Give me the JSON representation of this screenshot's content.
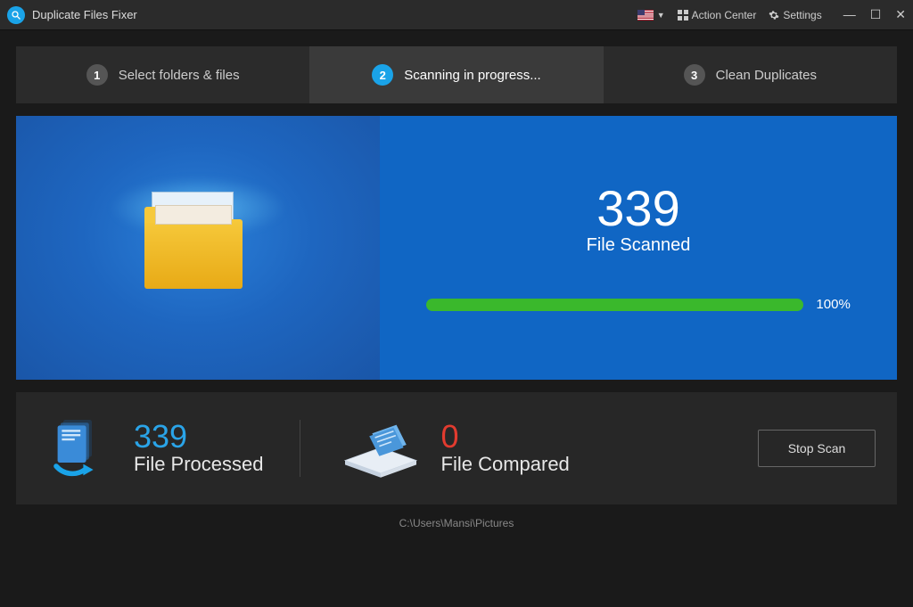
{
  "titlebar": {
    "app_name": "Duplicate Files Fixer",
    "action_center": "Action Center",
    "settings": "Settings"
  },
  "steps": {
    "s1_num": "1",
    "s1_label": "Select folders & files",
    "s2_num": "2",
    "s2_label": "Scanning in progress...",
    "s3_num": "3",
    "s3_label": "Clean Duplicates"
  },
  "hero": {
    "scanned_count": "339",
    "scanned_label": "File Scanned",
    "progress_pct": "100%",
    "progress_value": 100
  },
  "stats": {
    "processed_count": "339",
    "processed_label": "File Processed",
    "compared_count": "0",
    "compared_label": "File Compared"
  },
  "buttons": {
    "stop_scan": "Stop Scan"
  },
  "current_path": "C:\\Users\\Mansi\\Pictures"
}
